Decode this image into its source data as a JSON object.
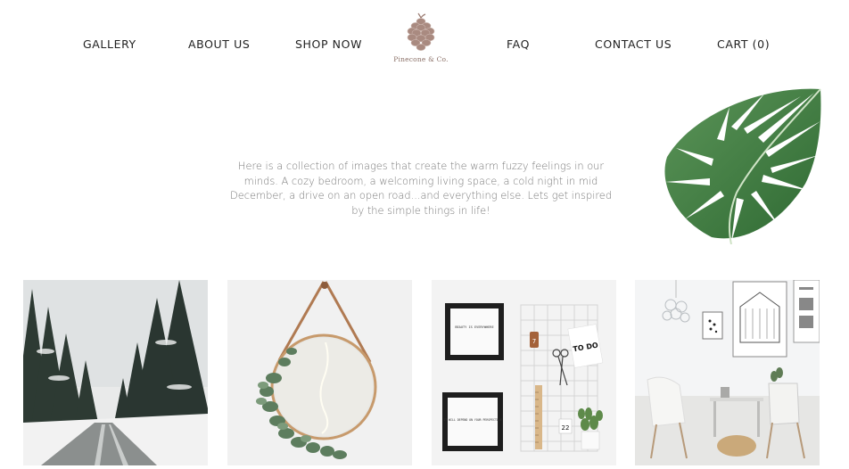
{
  "nav": {
    "left": [
      "GALLERY",
      "ABOUT  US",
      "SHOP  NOW"
    ],
    "right": [
      "FAQ",
      "CONTACT  US",
      "CART  (0)"
    ]
  },
  "logo": {
    "text": "Pinecone & Co.",
    "icon": "pinecone-icon",
    "color": "#a98a80"
  },
  "intro": {
    "text": "Here is a collection of images that create the warm fuzzy feelings in our minds. A cozy bedroom, a welcoming living space, a cold night in mid December, a drive on an open road...and everything else. Lets get inspired by the simple things in life!"
  },
  "decor": {
    "leaf": "monstera-leaf-image",
    "leaf_color": "#3d7a40"
  },
  "gallery": {
    "images": [
      "snowy-forest-road-photo",
      "round-mirror-photo",
      "framed-prints-wall-photo",
      "scandinavian-living-room-photo"
    ],
    "frame_texts": {
      "top": "BEAUTY IS EVERYWHERE",
      "bottom": "IT WILL DEPEND ON YOUR PERSPECTIVE"
    },
    "todo_card": "TO DO",
    "tag_number": "7",
    "calendar_number": "22"
  }
}
